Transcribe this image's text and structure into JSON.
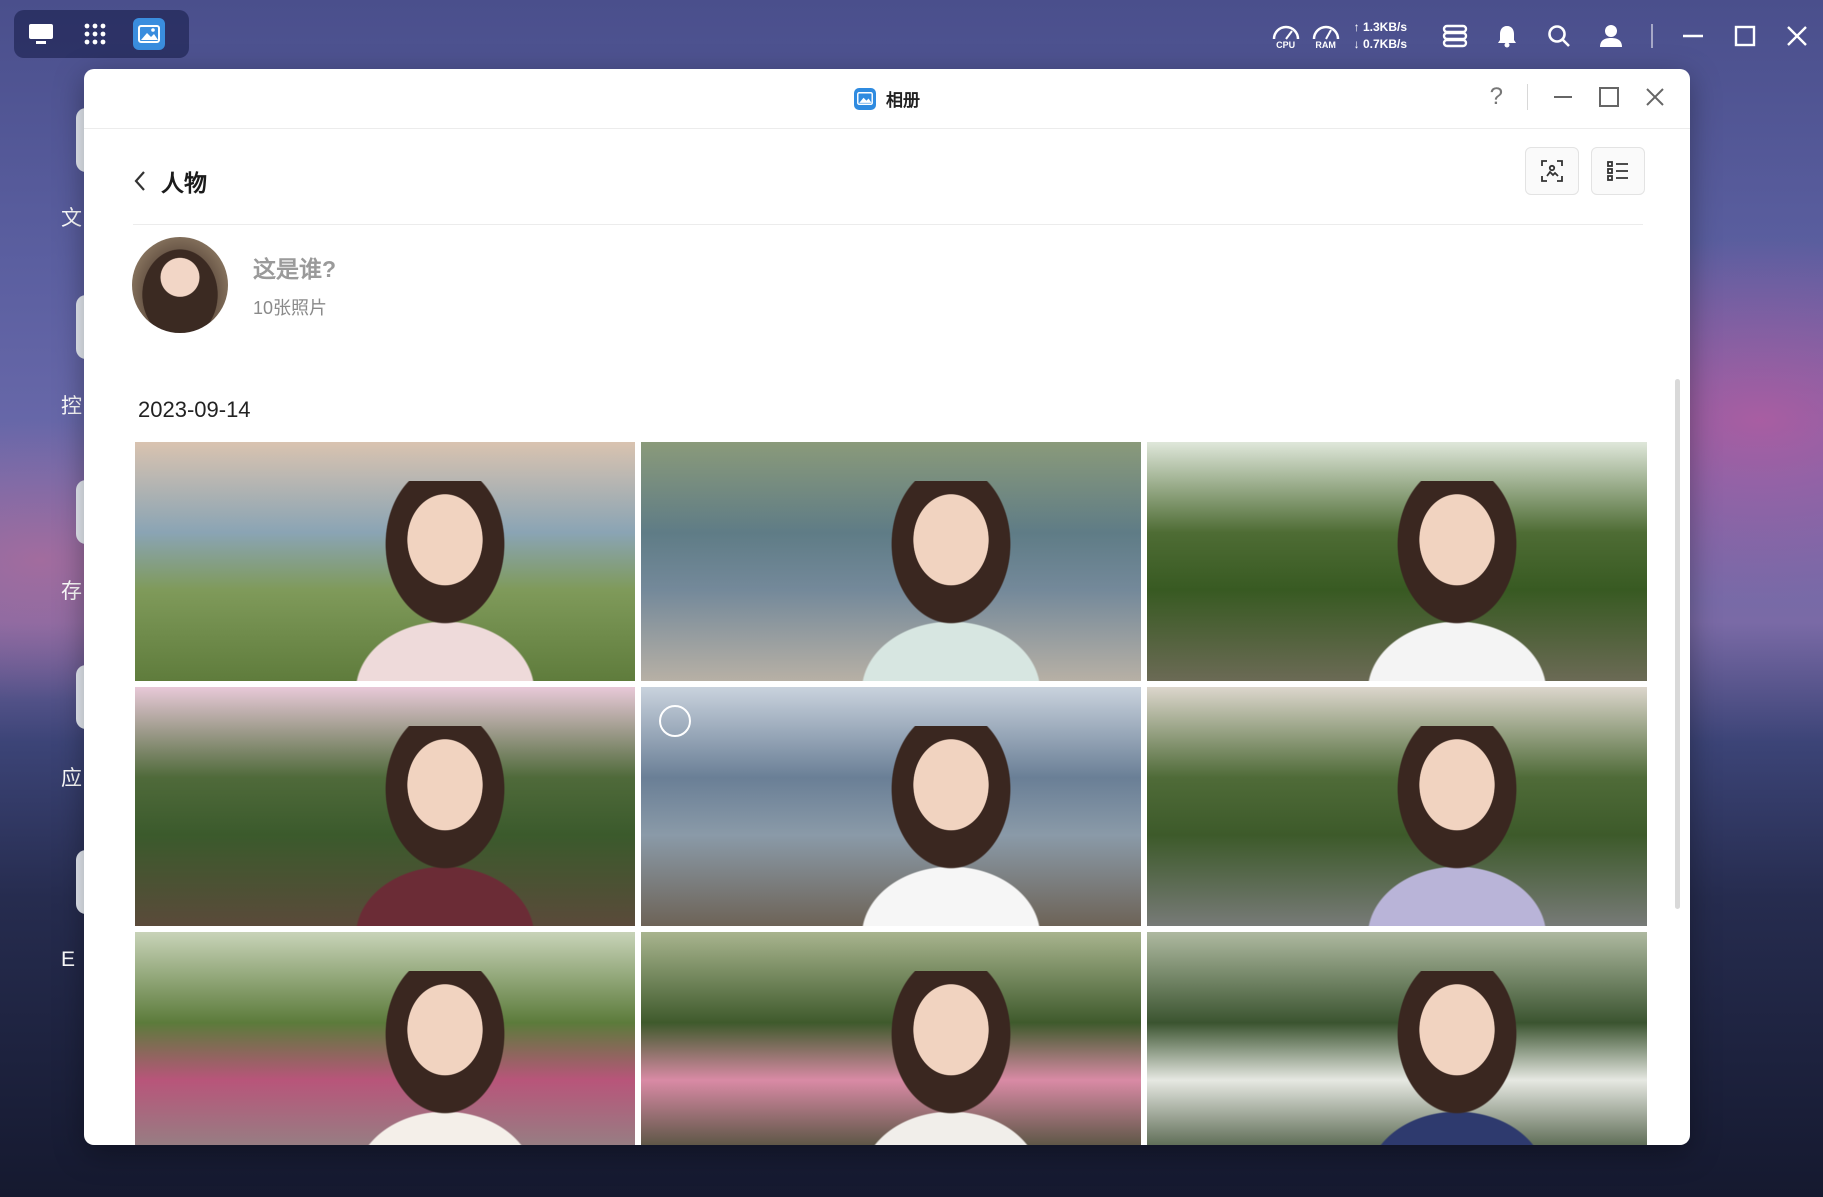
{
  "taskbar": {
    "cpu_label": "CPU",
    "ram_label": "RAM",
    "upload": "1.3KB/s",
    "download": "0.7KB/s"
  },
  "desktop": {
    "labels": [
      "文",
      "控",
      "存",
      "应",
      "E"
    ]
  },
  "window": {
    "title": "相册",
    "help": "?"
  },
  "header": {
    "title": "人物"
  },
  "person": {
    "name_prompt": "这是谁?",
    "photo_count": "10张照片"
  },
  "gallery": {
    "date": "2023-09-14",
    "photos": [
      {
        "scene": "seaside-lawn",
        "colors": [
          "#d9c3b0",
          "#8aa4b4",
          "#7f9a5a",
          "#5f7c3c"
        ],
        "cloth": "#eedada"
      },
      {
        "scene": "lake-shore",
        "colors": [
          "#8a9a7a",
          "#5f7c86",
          "#74899a",
          "#b7b0a5"
        ],
        "cloth": "#d7e6e1"
      },
      {
        "scene": "garden-pond",
        "colors": [
          "#dfe7da",
          "#4e6c34",
          "#385a22",
          "#6b6a55"
        ],
        "cloth": "#f4f4f4"
      },
      {
        "scene": "hydrangea-garden",
        "colors": [
          "#e8c9d8",
          "#4f6a3a",
          "#3b5a2c",
          "#5a4a3a"
        ],
        "cloth": "#6b2c36"
      },
      {
        "scene": "beach-island",
        "colors": [
          "#c9d2dd",
          "#6a7f96",
          "#8a9aa8",
          "#6d6357"
        ],
        "cloth": "#f6f6f6"
      },
      {
        "scene": "park-path",
        "colors": [
          "#dcd6cc",
          "#4f6b38",
          "#3d5a2a",
          "#777a77"
        ],
        "cloth": "#b9b4d8"
      },
      {
        "scene": "flower-bed",
        "colors": [
          "#c8d3b8",
          "#5c7b3b",
          "#b8557a",
          "#8a8d86"
        ],
        "cloth": "#f4efe9"
      },
      {
        "scene": "pink-roses",
        "colors": [
          "#a8b48e",
          "#3f5a2c",
          "#d98aa5",
          "#2e4322"
        ],
        "cloth": "#f1eeea"
      },
      {
        "scene": "white-blossoms",
        "colors": [
          "#aeb9a0",
          "#3b5430",
          "#e6e8e2",
          "#2c3f22"
        ],
        "cloth": "#2e3a6e"
      }
    ]
  }
}
